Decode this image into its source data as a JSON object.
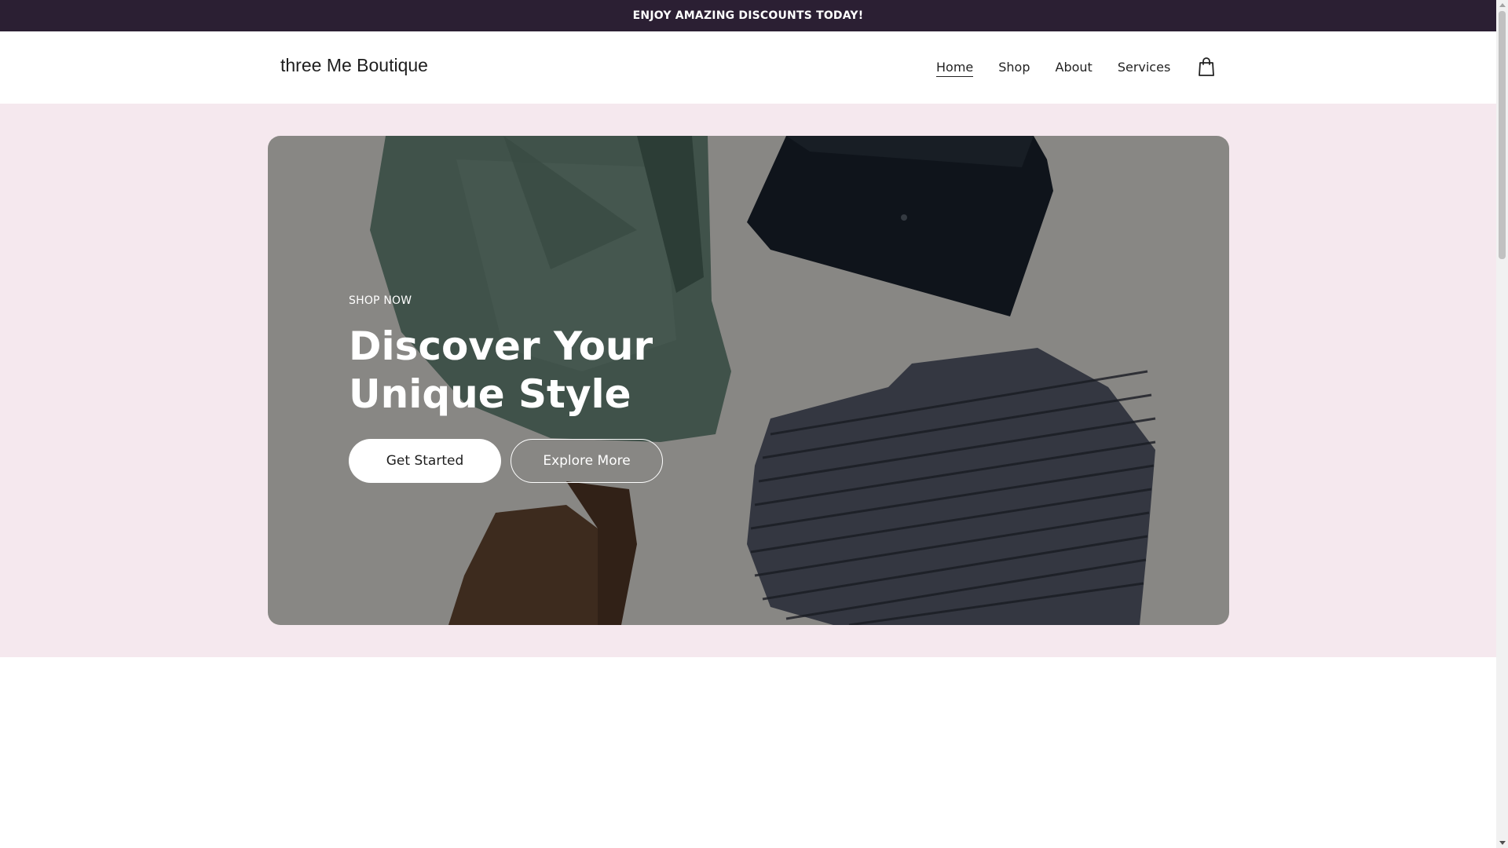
{
  "announcement": {
    "text": "ENJOY AMAZING DISCOUNTS TODAY!"
  },
  "header": {
    "brand": "three Me Boutique",
    "nav": [
      {
        "label": "Home",
        "active": true
      },
      {
        "label": "Shop",
        "active": false
      },
      {
        "label": "About",
        "active": false
      },
      {
        "label": "Services",
        "active": false
      }
    ],
    "cart_icon": "shopping-bag-icon"
  },
  "hero": {
    "eyebrow": "SHOP NOW",
    "headline_line1": "Discover Your",
    "headline_line2": "Unique Style",
    "primary_button": "Get Started",
    "secondary_button": "Explore More",
    "image_description_icon": "clothing-flatlay-image"
  },
  "colors": {
    "announcement_bg": "#2b1f33",
    "hero_band_bg": "#f5e8ee",
    "text_dark": "#1e1e1e"
  }
}
